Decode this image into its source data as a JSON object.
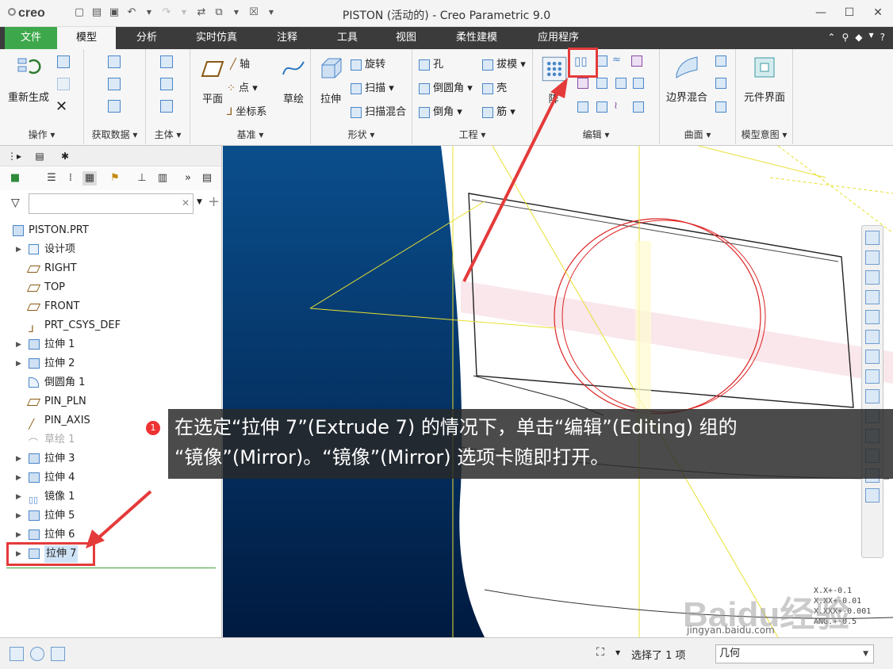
{
  "app": {
    "logo": "creo",
    "title": "PISTON (活动的) - Creo Parametric 9.0"
  },
  "tabs": [
    {
      "label": "文件"
    },
    {
      "label": "模型"
    },
    {
      "label": "分析"
    },
    {
      "label": "实时仿真"
    },
    {
      "label": "注释"
    },
    {
      "label": "工具"
    },
    {
      "label": "视图"
    },
    {
      "label": "柔性建模"
    },
    {
      "label": "应用程序"
    }
  ],
  "ribbon": {
    "operations": {
      "regenerate": "重新生成",
      "label": "操作"
    },
    "get_data": {
      "label": "获取数据"
    },
    "body": {
      "label": "主体"
    },
    "datum": {
      "plane": "平面",
      "axis": "轴",
      "point": "点",
      "csys": "坐标系",
      "sketch": "草绘",
      "label": "基准"
    },
    "shapes": {
      "extrude": "拉伸",
      "revolve": "旋转",
      "sweep": "扫描",
      "swept_blend": "扫描混合",
      "label": "形状"
    },
    "engineering": {
      "hole": "孔",
      "round": "倒圆角",
      "chamfer": "倒角",
      "draft": "拔模",
      "shell": "壳",
      "rib": "筋",
      "label": "工程"
    },
    "editing": {
      "pattern": "阵",
      "label": "编辑"
    },
    "surfaces": {
      "boundary_blend": "边界混合",
      "label": "曲面"
    },
    "model_intent": {
      "component_interface": "元件界面",
      "label": "模型意图"
    }
  },
  "tree": {
    "root": "PISTON.PRT",
    "items": [
      {
        "label": "设计项",
        "expandable": true,
        "icon": "layers-icon",
        "state": "normal"
      },
      {
        "label": "RIGHT",
        "expandable": false,
        "icon": "datum-plane-icon",
        "state": "normal"
      },
      {
        "label": "TOP",
        "expandable": false,
        "icon": "datum-plane-icon",
        "state": "normal"
      },
      {
        "label": "FRONT",
        "expandable": false,
        "icon": "datum-plane-icon",
        "state": "normal"
      },
      {
        "label": "PRT_CSYS_DEF",
        "expandable": false,
        "icon": "csys-icon",
        "state": "normal"
      },
      {
        "label": "拉伸 1",
        "expandable": true,
        "icon": "extrude-icon",
        "state": "normal"
      },
      {
        "label": "拉伸 2",
        "expandable": true,
        "icon": "extrude-icon",
        "state": "normal"
      },
      {
        "label": "倒圆角 1",
        "expandable": false,
        "icon": "round-icon",
        "state": "normal"
      },
      {
        "label": "PIN_PLN",
        "expandable": false,
        "icon": "datum-plane-icon",
        "state": "normal"
      },
      {
        "label": "PIN_AXIS",
        "expandable": false,
        "icon": "axis-icon",
        "state": "normal"
      },
      {
        "label": "草绘 1",
        "expandable": false,
        "icon": "sketch-icon",
        "state": "hidden"
      },
      {
        "label": "拉伸 3",
        "expandable": true,
        "icon": "extrude-icon",
        "state": "normal"
      },
      {
        "label": "拉伸 4",
        "expandable": true,
        "icon": "extrude-icon",
        "state": "normal"
      },
      {
        "label": "镜像 1",
        "expandable": true,
        "icon": "mirror-icon",
        "state": "normal"
      },
      {
        "label": "拉伸 5",
        "expandable": true,
        "icon": "extrude-icon",
        "state": "normal"
      },
      {
        "label": "拉伸 6",
        "expandable": true,
        "icon": "extrude-icon",
        "state": "normal"
      },
      {
        "label": "拉伸 7",
        "expandable": true,
        "icon": "extrude-icon",
        "state": "selected"
      }
    ]
  },
  "annotation": {
    "badge": "1",
    "line1": "在选定“拉伸 7”(Extrude 7) 的情况下，单击“编辑”(Editing) 组的",
    "line2": "“镜像”(Mirror)。“镜像”(Mirror) 选项卡随即打开。"
  },
  "viewport": {
    "tolerances": [
      "X.X+-0.1",
      "X.XX+-0.01",
      "X.XXX+-0.001",
      "ANG.+-0.5"
    ],
    "watermark": "Baidu经验",
    "watermark_url": "jingyan.baidu.com"
  },
  "status": {
    "selection": "选择了 1 项",
    "filter_value": "几何"
  }
}
